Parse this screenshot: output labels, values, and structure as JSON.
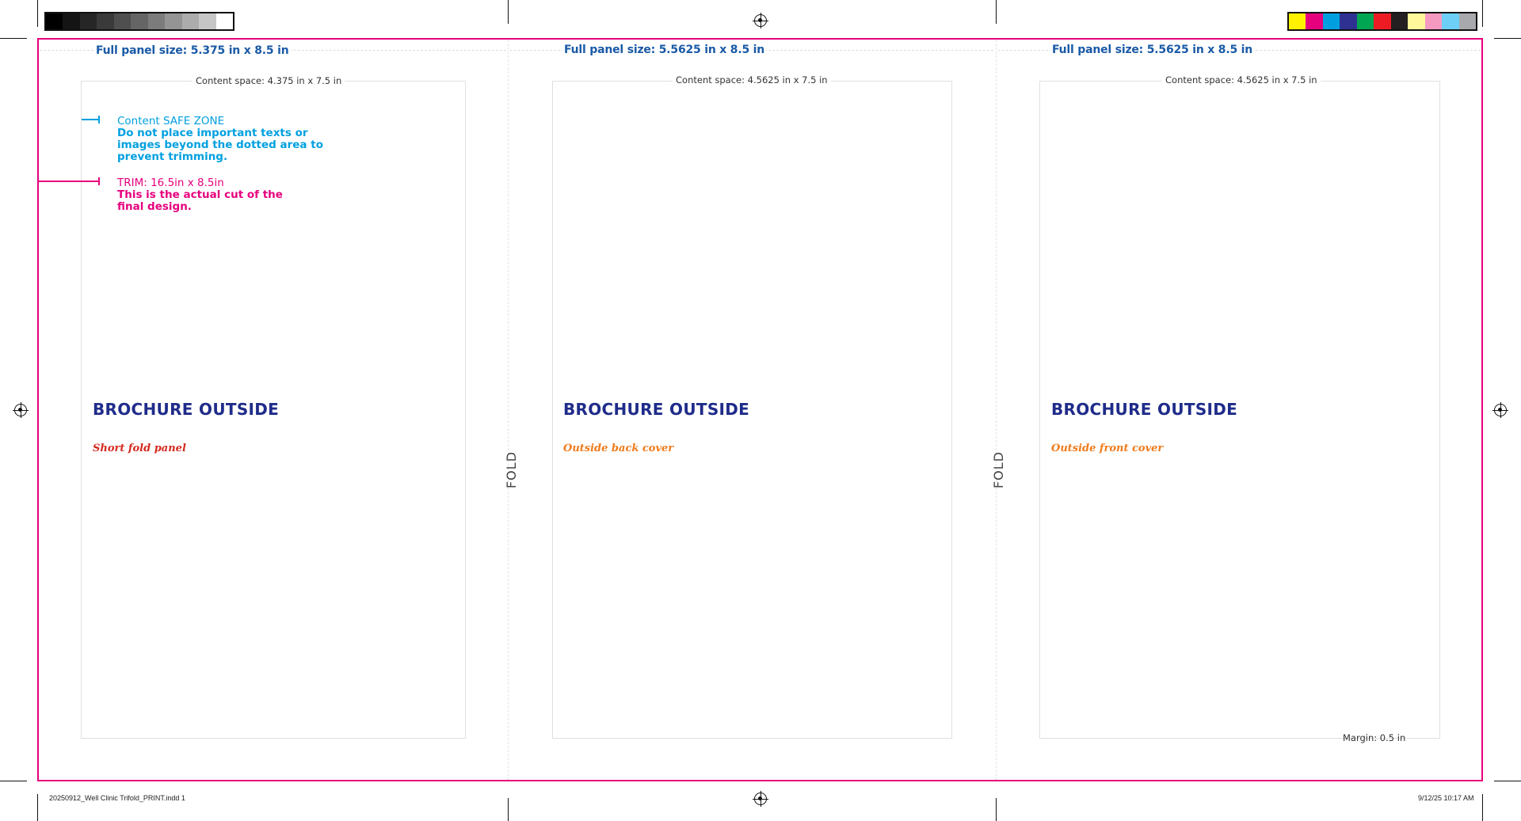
{
  "colors": {
    "trim": "#e6007e",
    "safe_zone": "#00a0e0",
    "panel_size_text": "#1a5aa6",
    "heading": "#1f2c8a",
    "short_fold_label": "#d42a1f",
    "cover_label": "#f07a1a"
  },
  "color_bars": {
    "grayscale": [
      "#000000",
      "#141414",
      "#262626",
      "#3a3a3a",
      "#4f4f4f",
      "#656565",
      "#7c7c7c",
      "#949494",
      "#acacac",
      "#c6c6c6",
      "#ffffff"
    ],
    "process": [
      "#fff200",
      "#e6007e",
      "#00a0e0",
      "#2e3192",
      "#00a651",
      "#ed1c24",
      "#231f20",
      "#fff79a",
      "#f49ac1",
      "#6dcff6",
      "#a7a9ac"
    ]
  },
  "panels": [
    {
      "full_size_label": "Full panel size: 5.375 in x 8.5 in",
      "content_space_label": "Content space: 4.375 in x 7.5 in",
      "heading": "BROCHURE OUTSIDE",
      "panel_name": "Short fold panel"
    },
    {
      "full_size_label": "Full panel size: 5.5625 in x 8.5 in",
      "content_space_label": "Content space: 4.5625 in x 7.5 in",
      "heading": "BROCHURE OUTSIDE",
      "panel_name": "Outside back cover"
    },
    {
      "full_size_label": "Full panel size: 5.5625 in x 8.5 in",
      "content_space_label": "Content space: 4.5625 in x 7.5 in",
      "heading": "BROCHURE OUTSIDE",
      "panel_name": "Outside front cover"
    }
  ],
  "folds": [
    "FOLD",
    "FOLD"
  ],
  "safe_zone_note": {
    "title": "Content SAFE ZONE",
    "line1": "Do not place important texts or",
    "line2": "images beyond the dotted area to",
    "line3": "prevent trimming."
  },
  "trim_note": {
    "title": "TRIM: 16.5in x 8.5in",
    "line1": "This is the actual cut of the",
    "line2": "final design."
  },
  "margin_label": "Margin: 0.5 in",
  "slug": {
    "filename": "20250912_Well Clinic Trifold_PRINT.indd   1",
    "datetime": "9/12/25   10:17 AM"
  }
}
